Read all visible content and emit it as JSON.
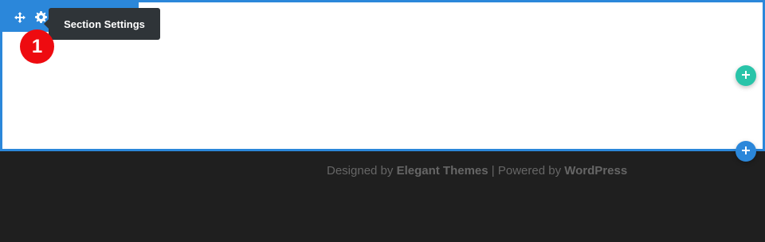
{
  "toolbar": {
    "tooltip": "Section Settings",
    "icons": [
      "move-icon",
      "gear-icon",
      "duplicate-icon",
      "power-icon",
      "trash-icon",
      "more-icon"
    ]
  },
  "step_badge": "1",
  "colors": {
    "section_border": "#2b87da",
    "toolbar_bg": "#2b87da",
    "tooltip_bg": "#2f3438",
    "badge_red": "#ee0b10",
    "add_row_green": "#29c4a9",
    "add_section_blue": "#2b87da",
    "footer_bg": "#1f1f1f",
    "footer_text": "#666666"
  },
  "footer": {
    "designed_by": "Designed by",
    "theme_link": "Elegant Themes",
    "separator": "|",
    "powered_by": "Powered by",
    "platform_link": "WordPress"
  }
}
